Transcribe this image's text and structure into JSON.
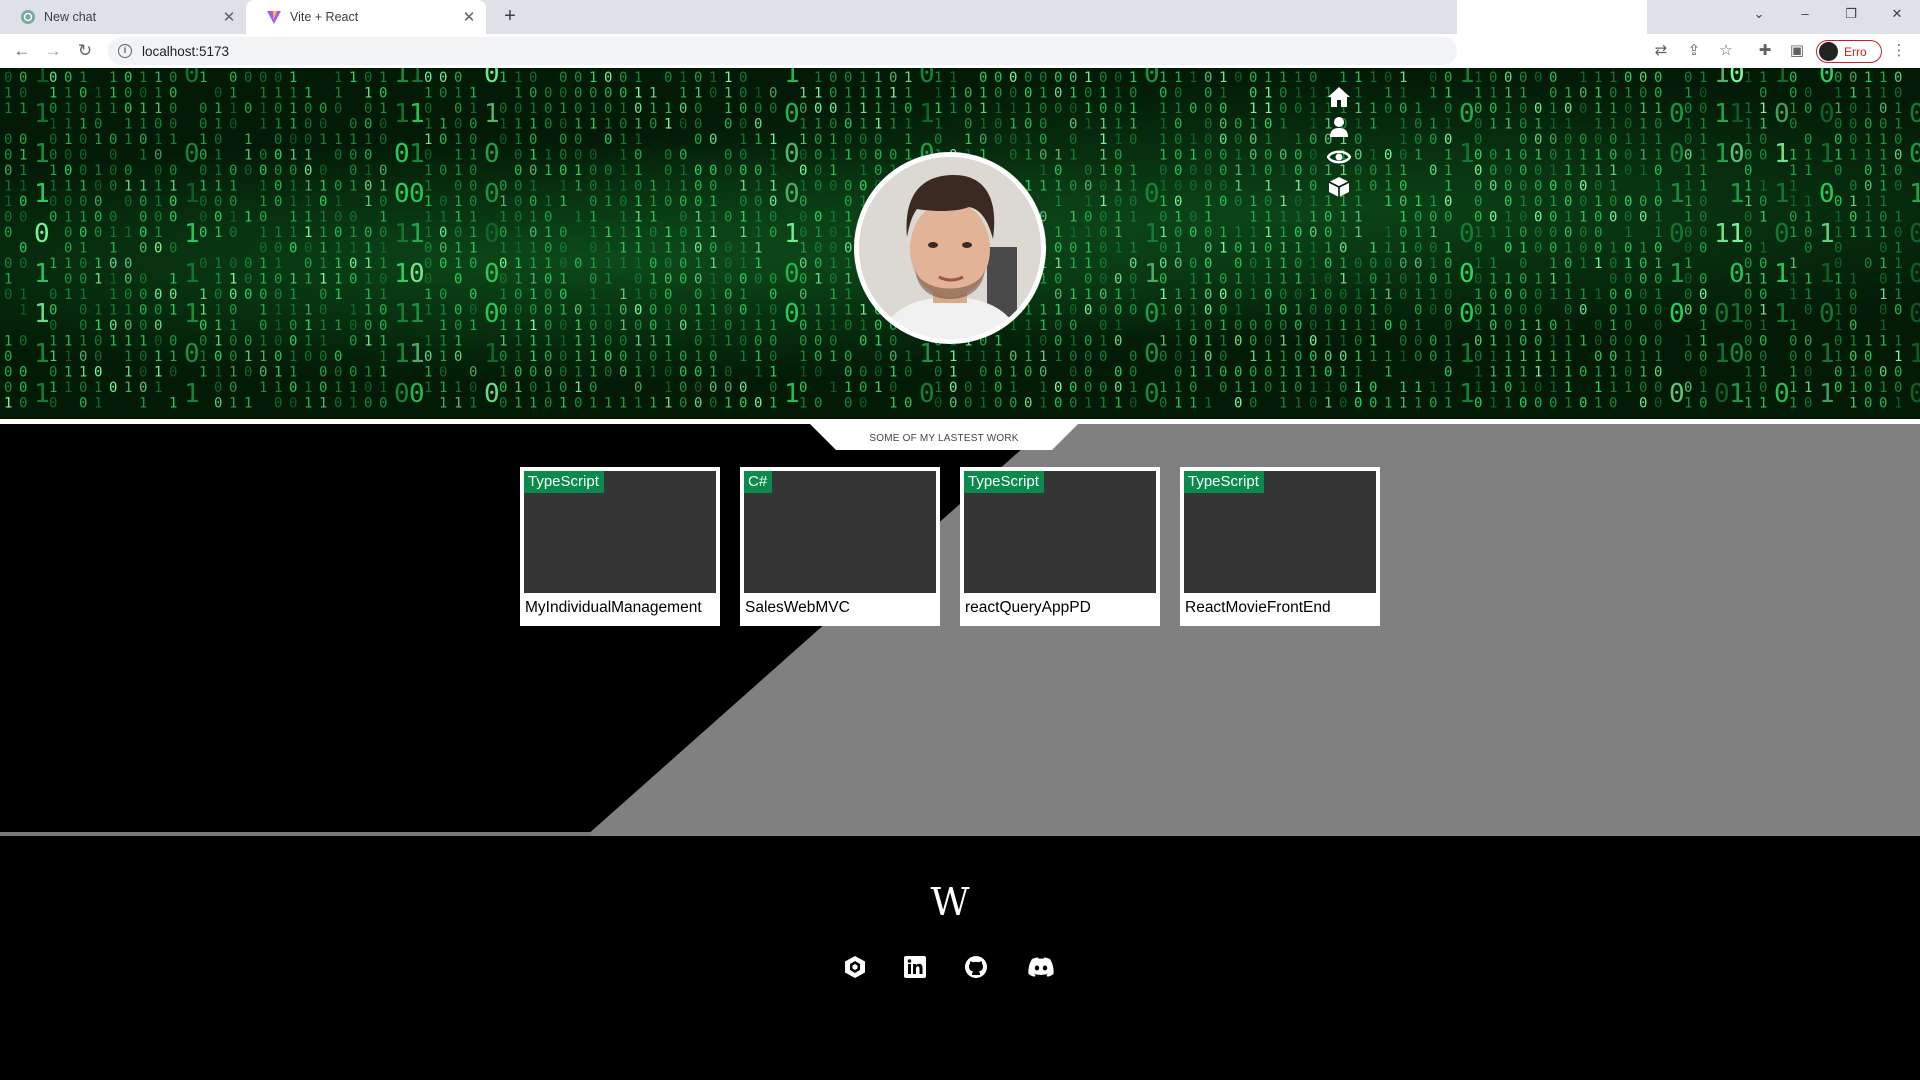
{
  "browser": {
    "tabs": [
      {
        "title": "New chat",
        "close": "✕"
      },
      {
        "title": "Vite + React",
        "close": "✕"
      }
    ],
    "new_tab": "+",
    "url": "localhost:5173",
    "profile_label": "Erro",
    "window_controls": {
      "tab_search": "⌄",
      "minimize": "–",
      "restore": "❐",
      "close": "✕"
    },
    "toolbar_icons": [
      "back-icon",
      "forward-icon",
      "reload-icon",
      "info-icon",
      "translate-icon",
      "share-icon",
      "star-icon",
      "extensions-icon",
      "side-panel-icon",
      "menu-icon"
    ]
  },
  "hero": {
    "nav_icons": [
      "home-icon",
      "user-icon",
      "eye-icon",
      "cube-icon"
    ],
    "background": "green binary matrix rain"
  },
  "works": {
    "section_label": "SOME OF MY LASTEST WORK",
    "projects": [
      {
        "language": "TypeScript",
        "name": "MyIndividualManagement"
      },
      {
        "language": "C#",
        "name": "SalesWebMVC"
      },
      {
        "language": "TypeScript",
        "name": "reactQueryAppPD"
      },
      {
        "language": "TypeScript",
        "name": "ReactMovieFrontEnd"
      }
    ]
  },
  "footer": {
    "logo": "W",
    "social_icons": [
      "unity-icon",
      "linkedin-icon",
      "github-icon",
      "discord-icon"
    ]
  },
  "colors": {
    "badge": "#0a8a4c",
    "matrix_green": "#2bd660",
    "gray_panel": "#808080",
    "card_thumb": "#353535"
  }
}
